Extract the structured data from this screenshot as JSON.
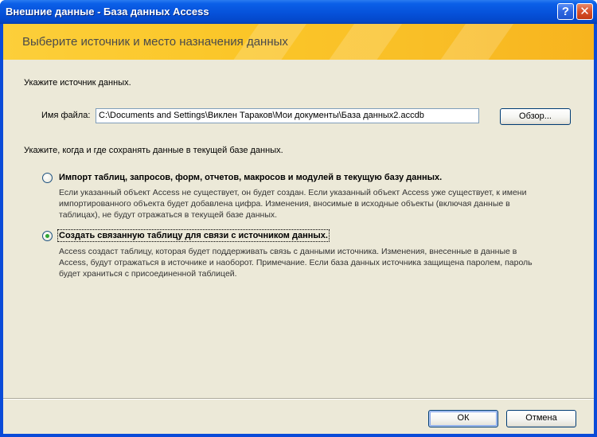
{
  "window": {
    "title": "Внешние данные - База данных Access",
    "help_glyph": "?",
    "close_glyph": "✕"
  },
  "banner": {
    "title": "Выберите источник и место назначения данных"
  },
  "source": {
    "heading": "Укажите источник данных.",
    "file_label": "Имя файла:",
    "file_path": "C:\\Documents and Settings\\Виклен Тараков\\Мои документы\\База данных2.accdb",
    "browse_label": "Обзор..."
  },
  "destination": {
    "heading": "Укажите, когда и где сохранять данные в текущей базе данных.",
    "options": [
      {
        "label": "Импорт таблиц, запросов, форм, отчетов, макросов и модулей в текущую базу данных.",
        "selected": false,
        "desc": [
          "Если указанный объект Access не существует, он будет создан. Если указанный объект Access уже существует, к имени",
          "импортированного объекта будет добавлена цифра. Изменения, вносимые в исходные объекты (включая данные в",
          "таблицах), не будут отражаться в текущей базе данных."
        ]
      },
      {
        "label": "Создать связанную таблицу для связи с источником данных.",
        "selected": true,
        "desc": [
          "Access создаст таблицу, которая будет поддерживать связь с данными источника. Изменения, внесенные в данные в",
          "Access, будут отражаться в источнике и наоборот. Примечание. Если база данных источника защищена паролем, пароль",
          "будет храниться с присоединенной таблицей."
        ]
      }
    ]
  },
  "footer": {
    "ok_label": "ОК",
    "cancel_label": "Отмена"
  },
  "colors": {
    "titlebar": "#0550d8",
    "banner": "#fbc628",
    "dialog_bg": "#ece9d8",
    "radio_selected": "#2fa632"
  }
}
